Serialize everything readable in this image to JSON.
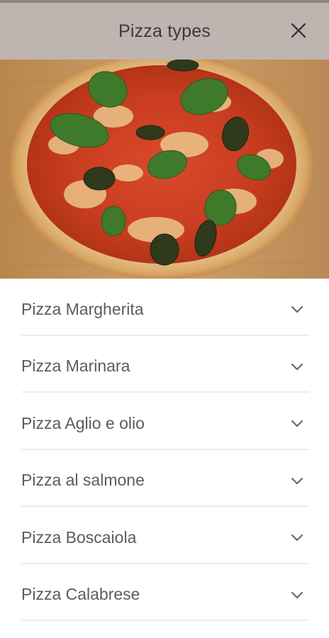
{
  "header": {
    "title": "Pizza types",
    "close_icon": "close-icon"
  },
  "hero": {
    "image": "pizza-margherita-photo"
  },
  "pizza_list": [
    {
      "label": "Pizza Margherita",
      "icon": "chevron-down-icon"
    },
    {
      "label": "Pizza Marinara",
      "icon": "chevron-down-icon"
    },
    {
      "label": "Pizza Aglio e olio",
      "icon": "chevron-down-icon"
    },
    {
      "label": "Pizza al salmone",
      "icon": "chevron-down-icon"
    },
    {
      "label": "Pizza Boscaiola",
      "icon": "chevron-down-icon"
    },
    {
      "label": "Pizza Calabrese",
      "icon": "chevron-down-icon"
    }
  ],
  "colors": {
    "header_bg": "#beb5b0",
    "divider": "#ececec",
    "text": "#5c5c5c"
  }
}
